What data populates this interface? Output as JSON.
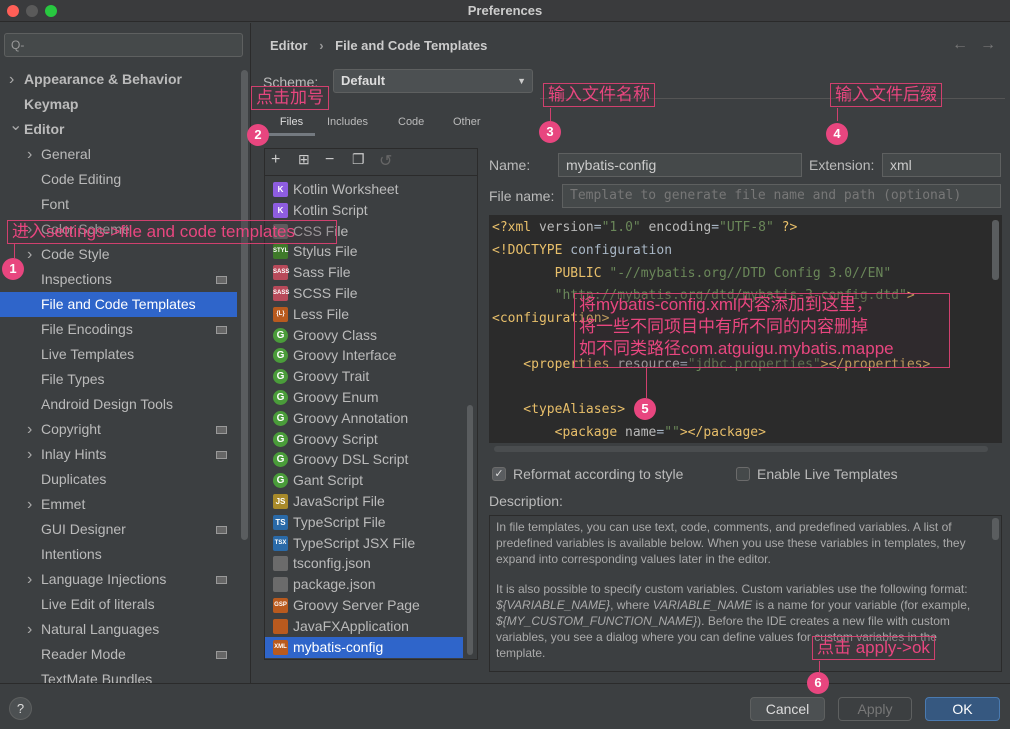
{
  "window": {
    "title": "Preferences"
  },
  "search": {
    "placeholder": "Q-"
  },
  "sidebar": {
    "items": [
      {
        "label": "Appearance & Behavior",
        "level": 0,
        "chevron": "right",
        "bold": true
      },
      {
        "label": "Keymap",
        "level": 0,
        "bold": true
      },
      {
        "label": "Editor",
        "level": 0,
        "chevron": "down",
        "bold": true
      },
      {
        "label": "General",
        "level": 1,
        "chevron": "right"
      },
      {
        "label": "Code Editing",
        "level": 1
      },
      {
        "label": "Font",
        "level": 1
      },
      {
        "label": "Color Scheme",
        "level": 1,
        "chevron": "right"
      },
      {
        "label": "Code Style",
        "level": 1,
        "chevron": "right"
      },
      {
        "label": "Inspections",
        "level": 1,
        "badge": true
      },
      {
        "label": "File and Code Templates",
        "level": 1,
        "selected": true
      },
      {
        "label": "File Encodings",
        "level": 1,
        "badge": true
      },
      {
        "label": "Live Templates",
        "level": 1
      },
      {
        "label": "File Types",
        "level": 1
      },
      {
        "label": "Android Design Tools",
        "level": 1
      },
      {
        "label": "Copyright",
        "level": 1,
        "chevron": "right",
        "badge": true
      },
      {
        "label": "Inlay Hints",
        "level": 1,
        "chevron": "right",
        "badge": true
      },
      {
        "label": "Duplicates",
        "level": 1
      },
      {
        "label": "Emmet",
        "level": 1,
        "chevron": "right"
      },
      {
        "label": "GUI Designer",
        "level": 1,
        "badge": true
      },
      {
        "label": "Intentions",
        "level": 1
      },
      {
        "label": "Language Injections",
        "level": 1,
        "chevron": "right",
        "badge": true
      },
      {
        "label": "Live Edit of literals",
        "level": 1
      },
      {
        "label": "Natural Languages",
        "level": 1,
        "chevron": "right"
      },
      {
        "label": "Reader Mode",
        "level": 1,
        "badge": true
      },
      {
        "label": "TextMate Bundles",
        "level": 1
      }
    ]
  },
  "breadcrumb": {
    "parent": "Editor",
    "separator": "›",
    "current": "File and Code Templates"
  },
  "scheme": {
    "label": "Scheme:",
    "value": "Default"
  },
  "tabs": [
    {
      "label": "Files",
      "active": true
    },
    {
      "label": "Includes"
    },
    {
      "label": "Code"
    },
    {
      "label": "Other"
    }
  ],
  "toolbar": {
    "add": "+",
    "add_child": "⊞",
    "remove": "−",
    "copy": "❐",
    "reset": "↺"
  },
  "files": [
    {
      "label": "Kotlin Worksheet",
      "icon": "kotlin",
      "color": "#8e5de0",
      "tag": "K"
    },
    {
      "label": "Kotlin Script",
      "icon": "kotlin",
      "color": "#8e5de0",
      "tag": "K"
    },
    {
      "label": "CSS File",
      "icon": "css",
      "color": "#6b6b6b",
      "tag": ""
    },
    {
      "label": "Stylus File",
      "icon": "stylus",
      "color": "#3f7a2a",
      "tag": "STYL"
    },
    {
      "label": "Sass File",
      "icon": "sass",
      "color": "#b84a5a",
      "tag": "SASS"
    },
    {
      "label": "SCSS File",
      "icon": "sass",
      "color": "#b84a5a",
      "tag": "SASS"
    },
    {
      "label": "Less File",
      "icon": "less",
      "color": "#b95a1e",
      "tag": "{L}"
    },
    {
      "label": "Groovy Class",
      "icon": "groovy",
      "tag": "G"
    },
    {
      "label": "Groovy Interface",
      "icon": "groovy",
      "tag": "G"
    },
    {
      "label": "Groovy Trait",
      "icon": "groovy",
      "tag": "G"
    },
    {
      "label": "Groovy Enum",
      "icon": "groovy",
      "tag": "G"
    },
    {
      "label": "Groovy Annotation",
      "icon": "groovy",
      "tag": "G"
    },
    {
      "label": "Groovy Script",
      "icon": "groovy",
      "tag": "G"
    },
    {
      "label": "Groovy DSL Script",
      "icon": "groovy",
      "tag": "G"
    },
    {
      "label": "Gant Script",
      "icon": "groovy",
      "tag": "G"
    },
    {
      "label": "JavaScript File",
      "icon": "js",
      "color": "#a88a2a",
      "tag": "JS"
    },
    {
      "label": "TypeScript File",
      "icon": "ts",
      "color": "#2a6aa8",
      "tag": "TS"
    },
    {
      "label": "TypeScript JSX File",
      "icon": "tsx",
      "color": "#2a6aa8",
      "tag": "TSX"
    },
    {
      "label": "tsconfig.json",
      "icon": "json",
      "color": "#6b6b6b",
      "tag": ""
    },
    {
      "label": "package.json",
      "icon": "json",
      "color": "#6b6b6b",
      "tag": ""
    },
    {
      "label": "Groovy Server Page",
      "icon": "gsp",
      "color": "#b95a1e",
      "tag": "GSP"
    },
    {
      "label": "JavaFXApplication",
      "icon": "javafx",
      "color": "#b95a1e",
      "tag": ""
    },
    {
      "label": "mybatis-config",
      "icon": "xml",
      "color": "#b95a1e",
      "tag": "XML",
      "selected": true
    }
  ],
  "form": {
    "name_label": "Name:",
    "name_value": "mybatis-config",
    "ext_label": "Extension:",
    "ext_value": "xml",
    "filename_label": "File name:",
    "filename_placeholder": "Template to generate file name and path (optional)"
  },
  "code": [
    [
      [
        "<?xml",
        "t"
      ],
      [
        " version",
        "a"
      ],
      [
        "=",
        "p"
      ],
      [
        "\"1.0\"",
        "s"
      ],
      [
        " encoding",
        "a"
      ],
      [
        "=",
        "p"
      ],
      [
        "\"UTF-8\"",
        "s"
      ],
      [
        " ?>",
        "t"
      ]
    ],
    [
      [
        "<!DOCTYPE",
        "t"
      ],
      [
        " configuration",
        "p"
      ]
    ],
    [
      [
        "        PUBLIC",
        "t"
      ],
      [
        " \"-//mybatis.org//DTD Config 3.0//EN\"",
        "s"
      ]
    ],
    [
      [
        "        \"http://mybatis.org/dtd/mybatis-3-config.dtd\"",
        "s"
      ],
      [
        ">",
        "t"
      ]
    ],
    [
      [
        "<configuration>",
        "t"
      ]
    ],
    [
      [
        "",
        ""
      ]
    ],
    [
      [
        "    <properties",
        "t"
      ],
      [
        " resource",
        "a"
      ],
      [
        "=",
        "p"
      ],
      [
        "\"jdbc.properties\"",
        "s"
      ],
      [
        "></properties>",
        "t"
      ]
    ],
    [
      [
        "",
        ""
      ]
    ],
    [
      [
        "    <typeAliases>",
        "t"
      ]
    ],
    [
      [
        "        <package",
        "t"
      ],
      [
        " name",
        "a"
      ],
      [
        "=",
        "p"
      ],
      [
        "\"\"",
        "s"
      ],
      [
        "></package>",
        "t"
      ]
    ]
  ],
  "options": {
    "reformat_label": "Reformat according to style",
    "reformat_checked": true,
    "live_label": "Enable Live Templates",
    "live_checked": false
  },
  "description": {
    "label": "Description:",
    "p1": "In file templates, you can use text, code, comments, and predefined variables. A list of predefined variables is available below. When you use these variables in templates, they expand into corresponding values later in the editor.",
    "p2a": "It is also possible to specify custom variables. Custom variables use the following format: ",
    "v1": "${VARIABLE_NAME}",
    "p2b": ", where ",
    "v2": "VARIABLE_NAME",
    "p2c": " is a name for your variable (for example, ",
    "v3": "${MY_CUSTOM_FUNCTION_NAME}",
    "p2d": "). Before the IDE creates a new file with custom variables, you see a dialog where you can define values for custom variables in the template."
  },
  "buttons": {
    "help": "?",
    "cancel": "Cancel",
    "apply": "Apply",
    "ok": "OK"
  },
  "annotations": {
    "n1": "1",
    "t1": "进入settings->file and code templates",
    "n2": "2",
    "t2": "点击加号",
    "n3": "3",
    "t3": "输入文件名称",
    "n4": "4",
    "t4": "输入文件后缀",
    "n5": "5",
    "t5a": "将mybatis-config.xml内容添加到这里，",
    "t5b": "将一些不同项目中有所不同的内容删掉",
    "t5c": "如不同类路径com.atguigu.mybatis.mappe",
    "n6": "6",
    "t6": "点击 apply->ok",
    "color": "#e8467f"
  },
  "colors": {
    "selection": "#2f65ca",
    "accent_annotation": "#e8467f"
  }
}
